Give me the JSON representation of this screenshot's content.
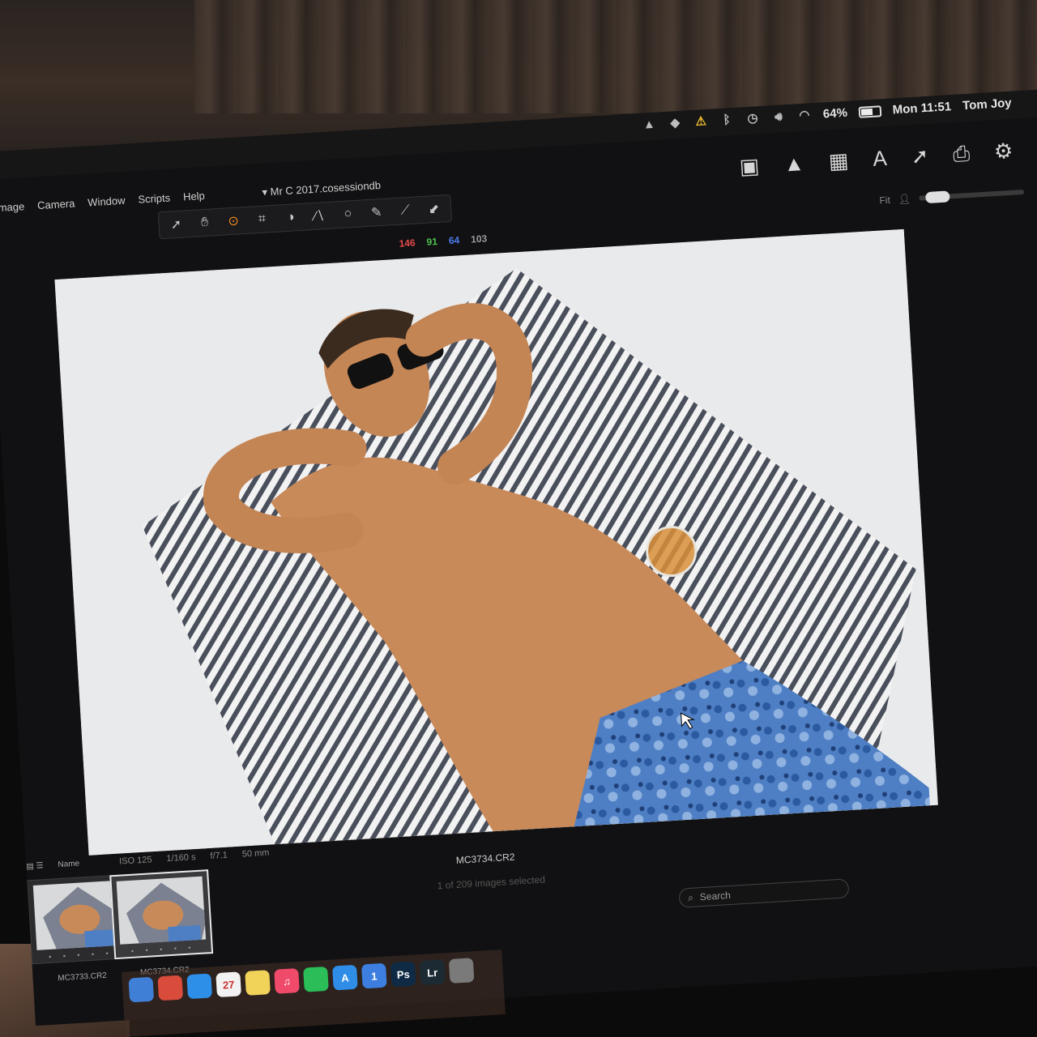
{
  "menubar": {
    "percent": "64%",
    "clock": "Mon 11:51",
    "user": "Tom Joy",
    "battery_level": 0.64,
    "status_icons": [
      "adobe-icon",
      "dropbox-icon",
      "warning-icon",
      "bluetooth-icon",
      "time-machine-icon",
      "volume-icon",
      "wifi-icon"
    ]
  },
  "app": {
    "menus": [
      "Image",
      "Camera",
      "Window",
      "Scripts",
      "Help"
    ],
    "session_title": "Mr C 2017.cosessiondb",
    "tools": [
      "select-icon",
      "pan-icon",
      "zoom-icon",
      "crop-icon",
      "rotate-icon",
      "keystone-icon",
      "spot-icon",
      "brush-icon",
      "eyedropper-icon",
      "picker-icon"
    ],
    "right_tools": [
      "compare-icon",
      "warning-icon",
      "grid-icon",
      "text-icon",
      "arrow-out-icon",
      "arrow-in-icon",
      "print-icon",
      "gear-icon"
    ],
    "fit_label": "Fit",
    "zoom_level": 0.1
  },
  "readout": {
    "r": "146",
    "g": "91",
    "b": "64",
    "l": "103"
  },
  "exif": {
    "iso": "ISO 125",
    "shutter": "1/160 s",
    "aperture": "f/7.1",
    "focal": "50 mm"
  },
  "viewer": {
    "filename": "MC3734.CR2",
    "selection": "1 of 209 images selected"
  },
  "browser": {
    "col_name": "Name",
    "search_placeholder": "Search",
    "thumbs": [
      {
        "name": "MC3733.CR2",
        "dots": "• • • • •"
      },
      {
        "name": "MC3734.CR2",
        "dots": "• • • • •"
      }
    ]
  },
  "dock": {
    "items": [
      {
        "name": "finder-icon",
        "glyph": "",
        "color": "#3f7fd6"
      },
      {
        "name": "chrome-icon",
        "glyph": "",
        "color": "#d94b3b"
      },
      {
        "name": "safari-icon",
        "glyph": "",
        "color": "#2d8fe8"
      },
      {
        "name": "calendar-icon",
        "glyph": "27",
        "color": "#f2f2f2"
      },
      {
        "name": "stickies-icon",
        "glyph": "",
        "color": "#f1d35a"
      },
      {
        "name": "music-icon",
        "glyph": "♫",
        "color": "#f04a6a"
      },
      {
        "name": "spotify-icon",
        "glyph": "",
        "color": "#2bbd57"
      },
      {
        "name": "appstore-icon",
        "glyph": "A",
        "color": "#2f8de8"
      },
      {
        "name": "onepassword-icon",
        "glyph": "1",
        "color": "#3c7fe0"
      },
      {
        "name": "photoshop-icon",
        "glyph": "Ps",
        "color": "#0f2a44"
      },
      {
        "name": "lightroom-icon",
        "glyph": "Lr",
        "color": "#1b2a33"
      },
      {
        "name": "preview-icon",
        "glyph": "",
        "color": "#7a7a7a"
      }
    ]
  },
  "colors": {
    "accent": "#f08a1c",
    "viewer_bg": "#e6e7e8",
    "app_bg": "#111113"
  }
}
